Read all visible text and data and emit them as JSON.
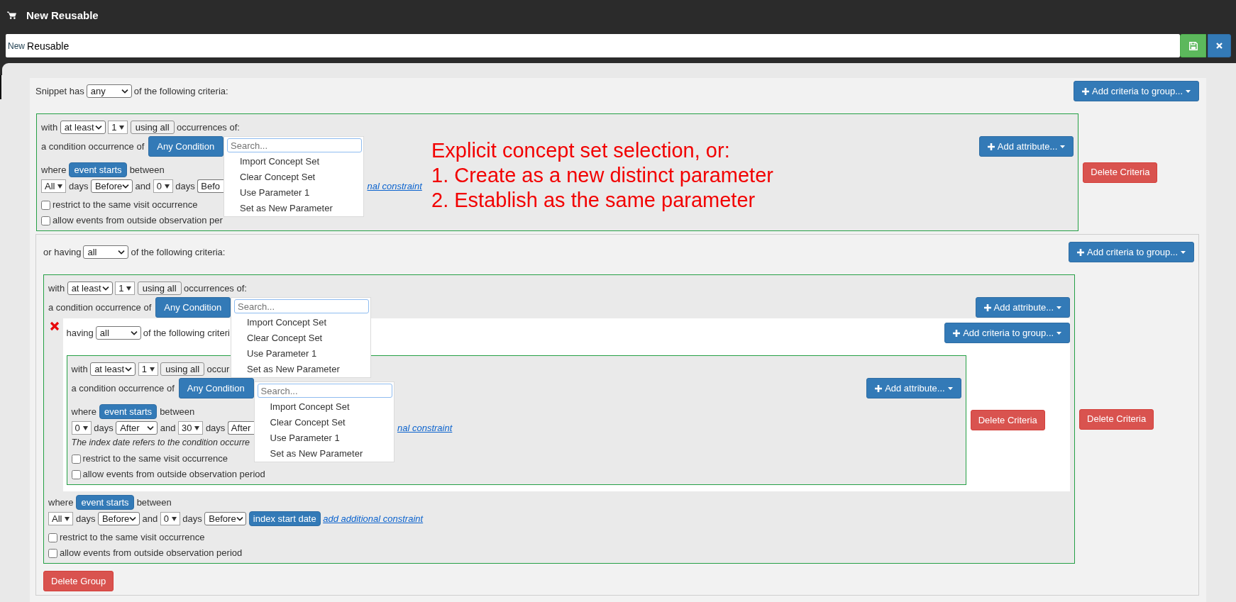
{
  "header": {
    "title": "New Reusable"
  },
  "name_field": {
    "prefix": "New",
    "value": "Reusable"
  },
  "annotation": {
    "lines": [
      "Explicit concept set selection, or:",
      "1. Create as a new distinct parameter",
      "2. Establish as the same parameter"
    ]
  },
  "root_group": {
    "prefix": "Snippet has",
    "match": "any",
    "suffix": "of the following criteria:",
    "add_button": "Add criteria to group...",
    "items": [
      {
        "kind": "criterion",
        "occurrence": {
          "label": "with",
          "type": "at least",
          "count": "1",
          "using": "using all",
          "suffix": "occurrences of:"
        },
        "domain": {
          "label": "a condition occurrence of",
          "concept": "Any Condition",
          "add_attribute": "Add attribute..."
        },
        "concept_menu": {
          "placeholder": "Search...",
          "items": [
            "Import Concept Set",
            "Clear Concept Set",
            "Use Parameter 1",
            "Set as New Parameter"
          ]
        },
        "window": {
          "label": "where",
          "event": "event starts",
          "suffix": "between",
          "values": [
            {
              "kind": "dropdown",
              "text": "All"
            },
            {
              "kind": "text",
              "text": "days"
            },
            {
              "kind": "select",
              "text": "Before"
            },
            {
              "kind": "text",
              "text": "and"
            },
            {
              "kind": "dropdown",
              "text": "0"
            },
            {
              "kind": "text",
              "text": "days"
            },
            {
              "kind": "select",
              "text": "Befo"
            }
          ],
          "beyond_menu": [
            {
              "kind": "link",
              "text": "nal constraint"
            }
          ]
        },
        "options": [
          {
            "label": "restrict to the same visit occurrence",
            "checked": false
          },
          {
            "label": "allow events from outside observation per",
            "checked": false
          }
        ],
        "delete_button": "Delete Criteria"
      },
      {
        "kind": "group",
        "prefix": "or having",
        "match": "all",
        "suffix": "of the following criteria:",
        "add_button": "Add criteria to group...",
        "delete_button": "Delete Group",
        "items": [
          {
            "kind": "criterion",
            "occurrence": {
              "label": "with",
              "type": "at least",
              "count": "1",
              "using": "using all",
              "suffix": "occurrences of:"
            },
            "domain": {
              "label": "a condition occurrence of",
              "concept": "Any Condition",
              "add_attribute": "Add attribute..."
            },
            "concept_menu": {
              "placeholder": "Search...",
              "items": [
                "Import Concept Set",
                "Clear Concept Set",
                "Use Parameter 1",
                "Set as New Parameter"
              ]
            },
            "nested_group": {
              "prefix": "having",
              "match": "all",
              "suffix": "of the following criteri",
              "add_button": "Add criteria to group...",
              "items": [
                {
                  "kind": "criterion",
                  "occurrence": {
                    "label": "with",
                    "type": "at least",
                    "count": "1",
                    "using": "using all",
                    "suffix": "occur"
                  },
                  "domain": {
                    "label": "a condition occurrence of",
                    "concept": "Any Condition",
                    "add_attribute": "Add attribute..."
                  },
                  "concept_menu": {
                    "placeholder": "Search...",
                    "items": [
                      "Import Concept Set",
                      "Clear Concept Set",
                      "Use Parameter 1",
                      "Set as New Parameter"
                    ]
                  },
                  "window": {
                    "label": "where",
                    "event": "event starts",
                    "suffix": "between",
                    "values": [
                      {
                        "kind": "dropdown",
                        "text": "0"
                      },
                      {
                        "kind": "text",
                        "text": "days"
                      },
                      {
                        "kind": "select",
                        "text": "After"
                      },
                      {
                        "kind": "text",
                        "text": "and"
                      },
                      {
                        "kind": "dropdown",
                        "text": "30"
                      },
                      {
                        "kind": "text",
                        "text": "days"
                      },
                      {
                        "kind": "select",
                        "text": "After"
                      }
                    ],
                    "beyond_menu": [
                      {
                        "kind": "link",
                        "text": "nal constraint"
                      }
                    ]
                  },
                  "note": "The index date refers to the condition occurre",
                  "options": [
                    {
                      "label": "restrict to the same visit occurrence",
                      "checked": false
                    },
                    {
                      "label": "allow events from outside observation period",
                      "checked": false
                    }
                  ],
                  "delete_button": "Delete Criteria"
                }
              ]
            },
            "window": {
              "label": "where",
              "event": "event starts",
              "suffix": "between",
              "values": [
                {
                  "kind": "dropdown",
                  "text": "All"
                },
                {
                  "kind": "text",
                  "text": "days"
                },
                {
                  "kind": "select",
                  "text": "Before"
                },
                {
                  "kind": "text",
                  "text": "and"
                },
                {
                  "kind": "dropdown",
                  "text": "0"
                },
                {
                  "kind": "text",
                  "text": "days"
                },
                {
                  "kind": "select",
                  "text": "Before"
                },
                {
                  "kind": "button",
                  "text": "index start date"
                },
                {
                  "kind": "link",
                  "text": "add additional constraint"
                }
              ]
            },
            "options": [
              {
                "label": "restrict to the same visit occurrence",
                "checked": false
              },
              {
                "label": "allow events from outside observation period",
                "checked": false
              }
            ],
            "delete_button": "Delete Criteria"
          }
        ]
      }
    ]
  }
}
